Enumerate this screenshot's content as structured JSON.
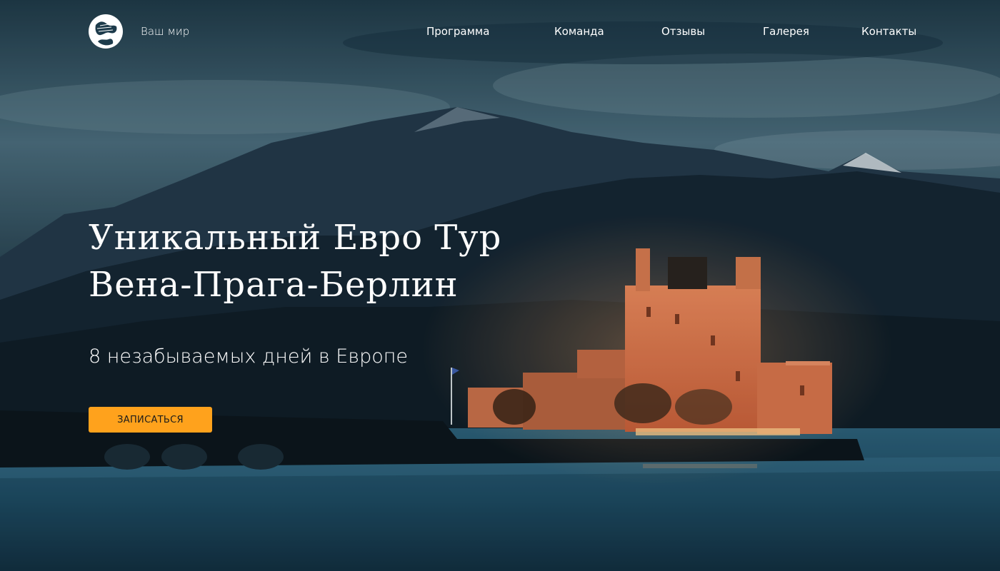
{
  "header": {
    "logo_icon": "globe-icon",
    "brand": "Ваш мир",
    "nav": [
      {
        "label": "Программа"
      },
      {
        "label": "Команда"
      },
      {
        "label": "Отзывы"
      },
      {
        "label": "Галерея"
      },
      {
        "label": "Контакты"
      }
    ]
  },
  "hero": {
    "title_line1": "Уникальный Евро Тур",
    "title_line2": "Вена-Прага-Берлин",
    "subtitle": "8 незабываемых дней в Европе",
    "cta_label": "ЗАПИСАТЬСЯ"
  },
  "colors": {
    "accent": "#ffa21c",
    "text": "#ffffff",
    "sky": "#3a5f70",
    "water": "#1c4a62"
  }
}
